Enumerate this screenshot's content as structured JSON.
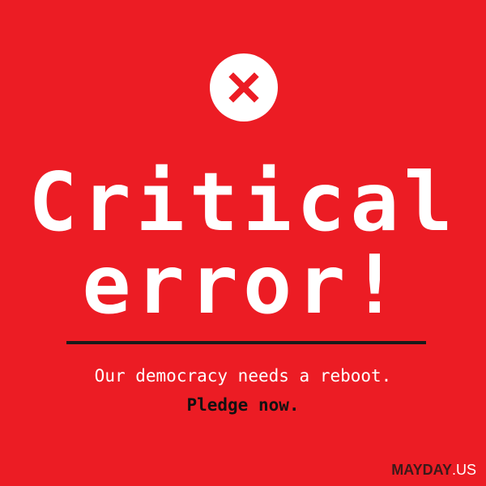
{
  "headline": {
    "line1": "Critical",
    "line2": "error!"
  },
  "tagline": "Our democracy needs a reboot.",
  "cta": "Pledge now.",
  "brand": {
    "name": "MAYDAY",
    "suffix": ".US"
  },
  "icon": {
    "name": "close-icon",
    "color": "#ec1c24"
  },
  "colors": {
    "background": "#ec1c24",
    "text_primary": "#ffffff",
    "text_dark": "#111111"
  }
}
